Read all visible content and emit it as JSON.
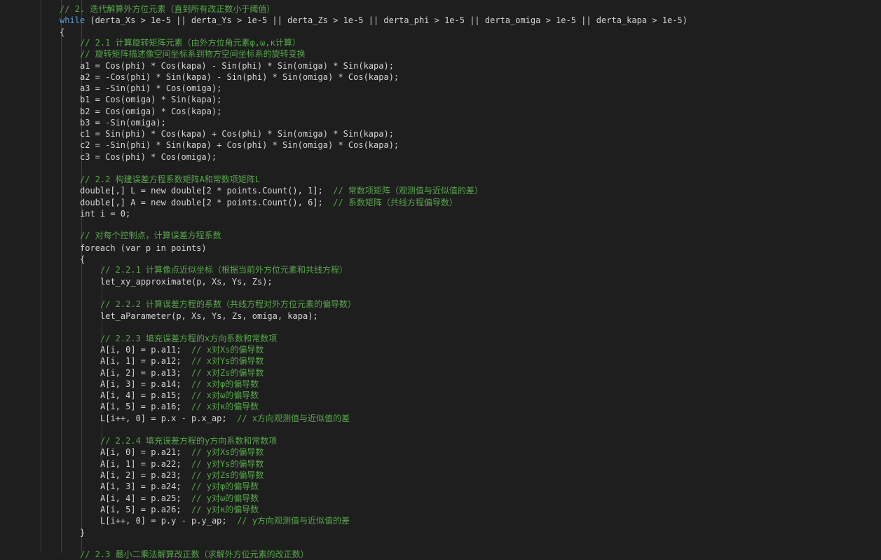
{
  "code": {
    "l1": "// 2. 迭代解算外方位元素（直到所有改正数小于阈值）",
    "l2_kw": "while",
    "l2_rest": " (derta_Xs > 1e-5 || derta_Ys > 1e-5 || derta_Zs > 1e-5 || derta_phi > 1e-5 || derta_omiga > 1e-5 || derta_kapa > 1e-5)",
    "l3": "{",
    "l4": "// 2.1 计算旋转矩阵元素（由外方位角元素φ,ω,κ计算）",
    "l5": "// 旋转矩阵描述像空间坐标系到物方空间坐标系的旋转变换",
    "l6": "a1 = Cos(phi) * Cos(kapa) - Sin(phi) * Sin(omiga) * Sin(kapa);",
    "l7": "a2 = -Cos(phi) * Sin(kapa) - Sin(phi) * Sin(omiga) * Cos(kapa);",
    "l8": "a3 = -Sin(phi) * Cos(omiga);",
    "l9": "b1 = Cos(omiga) * Sin(kapa);",
    "l10": "b2 = Cos(omiga) * Cos(kapa);",
    "l11": "b3 = -Sin(omiga);",
    "l12": "c1 = Sin(phi) * Cos(kapa) + Cos(phi) * Sin(omiga) * Sin(kapa);",
    "l13": "c2 = -Sin(phi) * Sin(kapa) + Cos(phi) * Sin(omiga) * Cos(kapa);",
    "l14": "c3 = Cos(phi) * Cos(omiga);",
    "l15": "// 2.2 构建误差方程系数矩阵A和常数项矩阵L",
    "l16_code": "double[,] L = new double[2 * points.Count(), 1];",
    "l16_cmt": "  // 常数项矩阵（观测值与近似值的差）",
    "l17_code": "double[,] A = new double[2 * points.Count(), 6];",
    "l17_cmt": "  // 系数矩阵（共线方程偏导数）",
    "l18": "int i = 0;",
    "l19": "// 对每个控制点，计算误差方程系数",
    "l20": "foreach (var p in points)",
    "l21": "{",
    "l22": "// 2.2.1 计算像点近似坐标（根据当前外方位元素和共线方程）",
    "l23": "let_xy_approximate(p, Xs, Ys, Zs);",
    "l24": "// 2.2.2 计算误差方程的系数（共线方程对外方位元素的偏导数）",
    "l25": "let_aParameter(p, Xs, Ys, Zs, omiga, kapa);",
    "l26": "// 2.2.3 填充误差方程的x方向系数和常数项",
    "l27_code": "A[i, 0] = p.a11;",
    "l27_cmt": "  // x对Xs的偏导数",
    "l28_code": "A[i, 1] = p.a12;",
    "l28_cmt": "  // x对Ys的偏导数",
    "l29_code": "A[i, 2] = p.a13;",
    "l29_cmt": "  // x对Zs的偏导数",
    "l30_code": "A[i, 3] = p.a14;",
    "l30_cmt": "  // x对φ的偏导数",
    "l31_code": "A[i, 4] = p.a15;",
    "l31_cmt": "  // x对ω的偏导数",
    "l32_code": "A[i, 5] = p.a16;",
    "l32_cmt": "  // x对κ的偏导数",
    "l33_code": "L[i++, 0] = p.x - p.x_ap;",
    "l33_cmt": "  // x方向观测值与近似值的差",
    "l34": "// 2.2.4 填充误差方程的y方向系数和常数项",
    "l35_code": "A[i, 0] = p.a21;",
    "l35_cmt": "  // y对Xs的偏导数",
    "l36_code": "A[i, 1] = p.a22;",
    "l36_cmt": "  // y对Ys的偏导数",
    "l37_code": "A[i, 2] = p.a23;",
    "l37_cmt": "  // y对Zs的偏导数",
    "l38_code": "A[i, 3] = p.a24;",
    "l38_cmt": "  // y对φ的偏导数",
    "l39_code": "A[i, 4] = p.a25;",
    "l39_cmt": "  // y对ω的偏导数",
    "l40_code": "A[i, 5] = p.a26;",
    "l40_cmt": "  // y对κ的偏导数",
    "l41_code": "L[i++, 0] = p.y - p.y_ap;",
    "l41_cmt": "  // y方向观测值与近似值的差",
    "l42": "}",
    "l43": "// 2.3 最小二乘法解算改正数（求解外方位元素的改正数）"
  },
  "colors": {
    "background": "#1e1e1e",
    "comment": "#57a64a",
    "keyword": "#569cd6",
    "text": "#d4d4d4"
  }
}
